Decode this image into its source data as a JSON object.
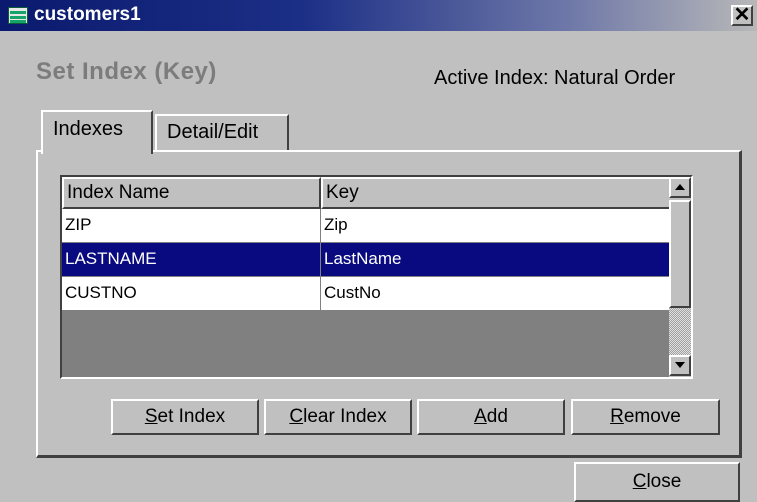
{
  "window": {
    "title": "customers1",
    "icon": "table-icon",
    "close_glyph": "✕"
  },
  "heading": "Set Index (Key)",
  "active_index": "Active Index: Natural Order",
  "tabs": [
    {
      "label": "Indexes",
      "selected": true
    },
    {
      "label": "Detail/Edit",
      "selected": false
    }
  ],
  "grid": {
    "columns": [
      "Index Name",
      "Key"
    ],
    "rows": [
      {
        "name": "ZIP",
        "key": "Zip",
        "selected": false
      },
      {
        "name": "LASTNAME",
        "key": "LastName",
        "selected": true
      },
      {
        "name": "CUSTNO",
        "key": "CustNo",
        "selected": false
      }
    ]
  },
  "buttons": {
    "set_index": {
      "mnemonic": "S",
      "rest": "et Index"
    },
    "clear_index": {
      "mnemonic": "C",
      "rest": "lear Index"
    },
    "add": {
      "mnemonic": "A",
      "rest": "dd"
    },
    "remove": {
      "mnemonic": "R",
      "rest": "emove"
    },
    "close": {
      "mnemonic": "C",
      "rest": "lose"
    }
  },
  "colors": {
    "title_bar": "#0a1a6e",
    "selection": "#0a0a80",
    "face": "#c0c0c0"
  }
}
